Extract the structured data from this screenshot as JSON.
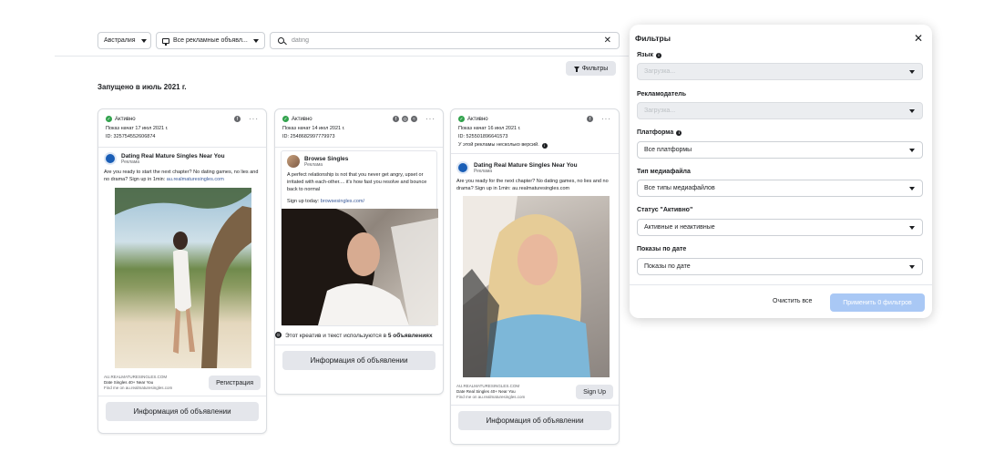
{
  "topbar": {
    "country": "Австралия",
    "ad_type": "Все рекламные объявл...",
    "search_value": "dating"
  },
  "filter_button": "Фильтры",
  "launched_label": "Запущено в июль 2021 г.",
  "cards": [
    {
      "status": "Активно",
      "started": "Показ начат 17 июл 2021 г.",
      "id": "ID: 325754552606874",
      "page_name": "Dating Real Mature Singles Near You",
      "sponsored": "Реклама",
      "text": "Are you ready to start the next chapter? No dating games, no lies and no drama? Sign up in 1min: ",
      "link": "au.realmaturesingles.com",
      "footer_domain": "AU.REALMATURESINGLES.COM",
      "footer_title": "Date Singles 40+ Near You",
      "footer_sub": "Find me on au.realmaturesingles.com",
      "cta": "Регистрация",
      "info_button": "Информация об объявлении"
    },
    {
      "status": "Активно",
      "started": "Показ начат 14 июл 2021 г.",
      "id": "ID: 2548682997779973",
      "page_name": "Browse Singles",
      "sponsored": "Реклама",
      "text": "A perfect relationship is not that you never get angry, upset or irritated with each-other.... it's how fast you resolve and bounce back to normal",
      "signup_prefix": "Sign up today: ",
      "link": "browsesingles.com/",
      "creative_note": "Этот креатив и текст используются в ",
      "creative_count": "5 объявлениях",
      "info_button": "Информация об объявлении"
    },
    {
      "status": "Активно",
      "started": "Показ начат 16 июл 2021 г.",
      "id": "ID: 525501896641573",
      "versions": "У этой рекламы несколько версий.",
      "page_name": "Dating Real Mature Singles Near You",
      "sponsored": "Реклама",
      "text": "Are you ready for the next chapter? No dating games, no lies and no drama? Sign up in 1min: au.realmaturesingles.com",
      "footer_domain": "AU.REALMATURESINGLES.COM",
      "footer_title": "Date Real Singles 40+ Near You",
      "footer_sub": "Find me on au.realmaturesingles.com",
      "cta": "Sign Up",
      "info_button": "Информация об объявлении"
    }
  ],
  "panel": {
    "title": "Фильтры",
    "filters": [
      {
        "label": "Язык",
        "value": "Загрузка...",
        "disabled": true,
        "info": true
      },
      {
        "label": "Рекламодатель",
        "value": "Загрузка...",
        "disabled": true,
        "info": false
      },
      {
        "label": "Платформа",
        "value": "Все платформы",
        "disabled": false,
        "info": true
      },
      {
        "label": "Тип медиафайла",
        "value": "Все типы медиафайлов",
        "disabled": false,
        "info": false
      },
      {
        "label": "Статус \"Активно\"",
        "value": "Активные и неактивные",
        "disabled": false,
        "info": false
      },
      {
        "label": "Показы по дате",
        "value": "Показы по дате",
        "disabled": false,
        "info": false
      }
    ],
    "clear_button": "Очистить все",
    "apply_button": "Применить 0 фильтров"
  },
  "icons": {
    "status": "check-circle-icon",
    "platform": "facebook-icon",
    "more": "more-dots-icon",
    "search": "search-icon",
    "close": "close-icon"
  },
  "colors": {
    "active_green": "#31a24c",
    "apply_button": "#a9c8f5",
    "link": "#385898"
  }
}
